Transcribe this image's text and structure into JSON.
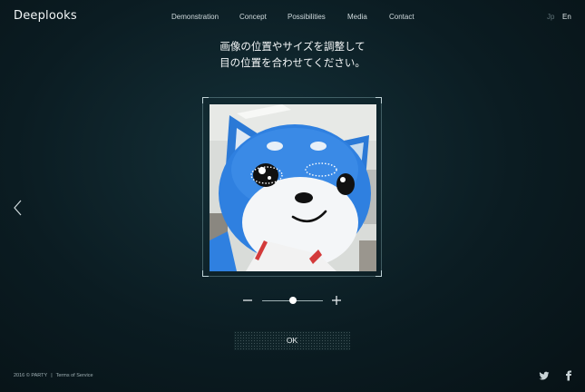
{
  "brand": {
    "logo": "Deeplooks"
  },
  "nav": {
    "items": [
      {
        "label": "Demonstration"
      },
      {
        "label": "Concept"
      },
      {
        "label": "Possibilities"
      },
      {
        "label": "Media"
      },
      {
        "label": "Contact"
      }
    ]
  },
  "language": {
    "jp": "Jp",
    "en": "En",
    "active": "En"
  },
  "instruction": {
    "line1": "画像の位置やサイズを調整して",
    "line2": "目の位置を合わせてください。"
  },
  "editor": {
    "image": "blue-dog-mascot-photo",
    "zoom_level": 0.5
  },
  "actions": {
    "ok_label": "OK"
  },
  "footer": {
    "copyright": "2016 © PARTY",
    "separator": "|",
    "terms": "Terms of Service"
  },
  "icons": {
    "prev": "chevron-left-icon",
    "zoom_out": "minus-icon",
    "zoom_in": "plus-icon",
    "twitter": "twitter-icon",
    "facebook": "facebook-icon"
  },
  "colors": {
    "background": "#0b1c22",
    "text": "#e8eef0",
    "muted": "#5f7277"
  }
}
